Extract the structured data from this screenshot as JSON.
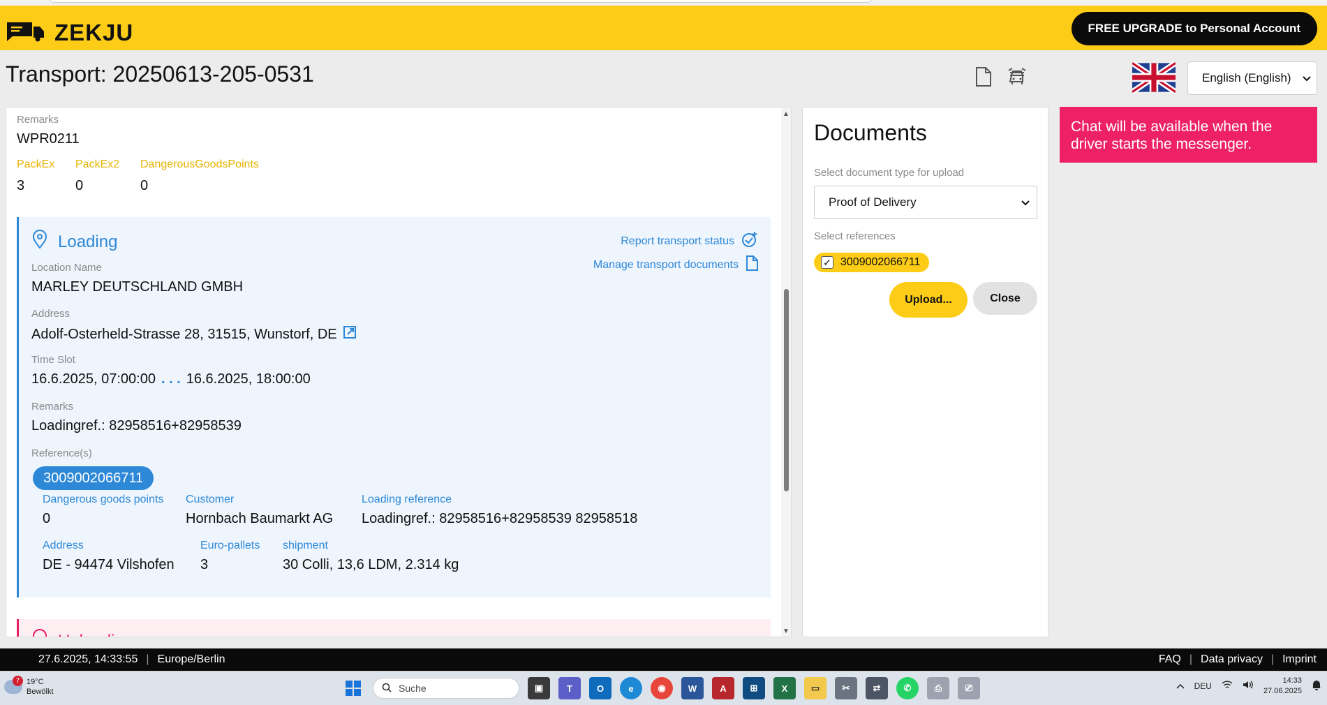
{
  "header": {
    "brand": "ZEKJU",
    "upgrade_label": "FREE UPGRADE to Personal Account",
    "page_title": "Transport: 20250613-205-0531",
    "language": "English (English)"
  },
  "summary": {
    "remarks_label": "Remarks",
    "remarks_value": "WPR0211",
    "packex_label": "PackEx",
    "packex_value": "3",
    "packex2_label": "PackEx2",
    "packex2_value": "0",
    "dgp_label": "DangerousGoodsPoints",
    "dgp_value": "0"
  },
  "loading": {
    "title": "Loading",
    "report_status": "Report transport status",
    "manage_docs": "Manage transport documents",
    "location_label": "Location Name",
    "location_value": "MARLEY DEUTSCHLAND GMBH",
    "address_label": "Address",
    "address_value": "Adolf-Osterheld-Strasse 28, 31515, Wunstorf, DE",
    "timeslot_label": "Time Slot",
    "timeslot_start": "16.6.2025, 07:00:00",
    "timeslot_sep": ". . .",
    "timeslot_end": "16.6.2025, 18:00:00",
    "remarks_label": "Remarks",
    "remarks_value": "Loadingref.: 82958516+82958539",
    "references_label": "Reference(s)",
    "reference": "3009002066711",
    "dgp_label": "Dangerous goods points",
    "dgp_value": "0",
    "customer_label": "Customer",
    "customer_value": "Hornbach Baumarkt AG",
    "loadref_label": "Loading reference",
    "loadref_value": "Loadingref.: 82958516+82958539 82958518",
    "ref_address_label": "Address",
    "ref_address_value": "DE - 94474 Vilshofen",
    "europallets_label": "Euro-pallets",
    "europallets_value": "3",
    "shipment_label": "shipment",
    "shipment_value": "30 Colli, 13,6 LDM, 2.314 kg"
  },
  "unloading": {
    "title": "Unloading"
  },
  "documents": {
    "title": "Documents",
    "type_label": "Select document type for upload",
    "type_value": "Proof of Delivery",
    "refs_label": "Select references",
    "ref_chip": "3009002066711",
    "upload_label": "Upload...",
    "close_label": "Close"
  },
  "chat_notice": "Chat will be available when the driver starts the messenger.",
  "footer": {
    "datetime": "27.6.2025, 14:33:55",
    "timezone": "Europe/Berlin",
    "faq": "FAQ",
    "privacy": "Data privacy",
    "imprint": "Imprint"
  },
  "taskbar": {
    "weather_badge": "7",
    "temperature": "19°C",
    "condition": "Bewölkt",
    "search_placeholder": "Suche",
    "keyboard_lang": "DEU",
    "time": "14:33",
    "date": "27.06.2025"
  },
  "colors": {
    "brand_yellow": "#fdcc17",
    "accent_blue": "#2e88d8",
    "chat_pink": "#ee2166"
  }
}
